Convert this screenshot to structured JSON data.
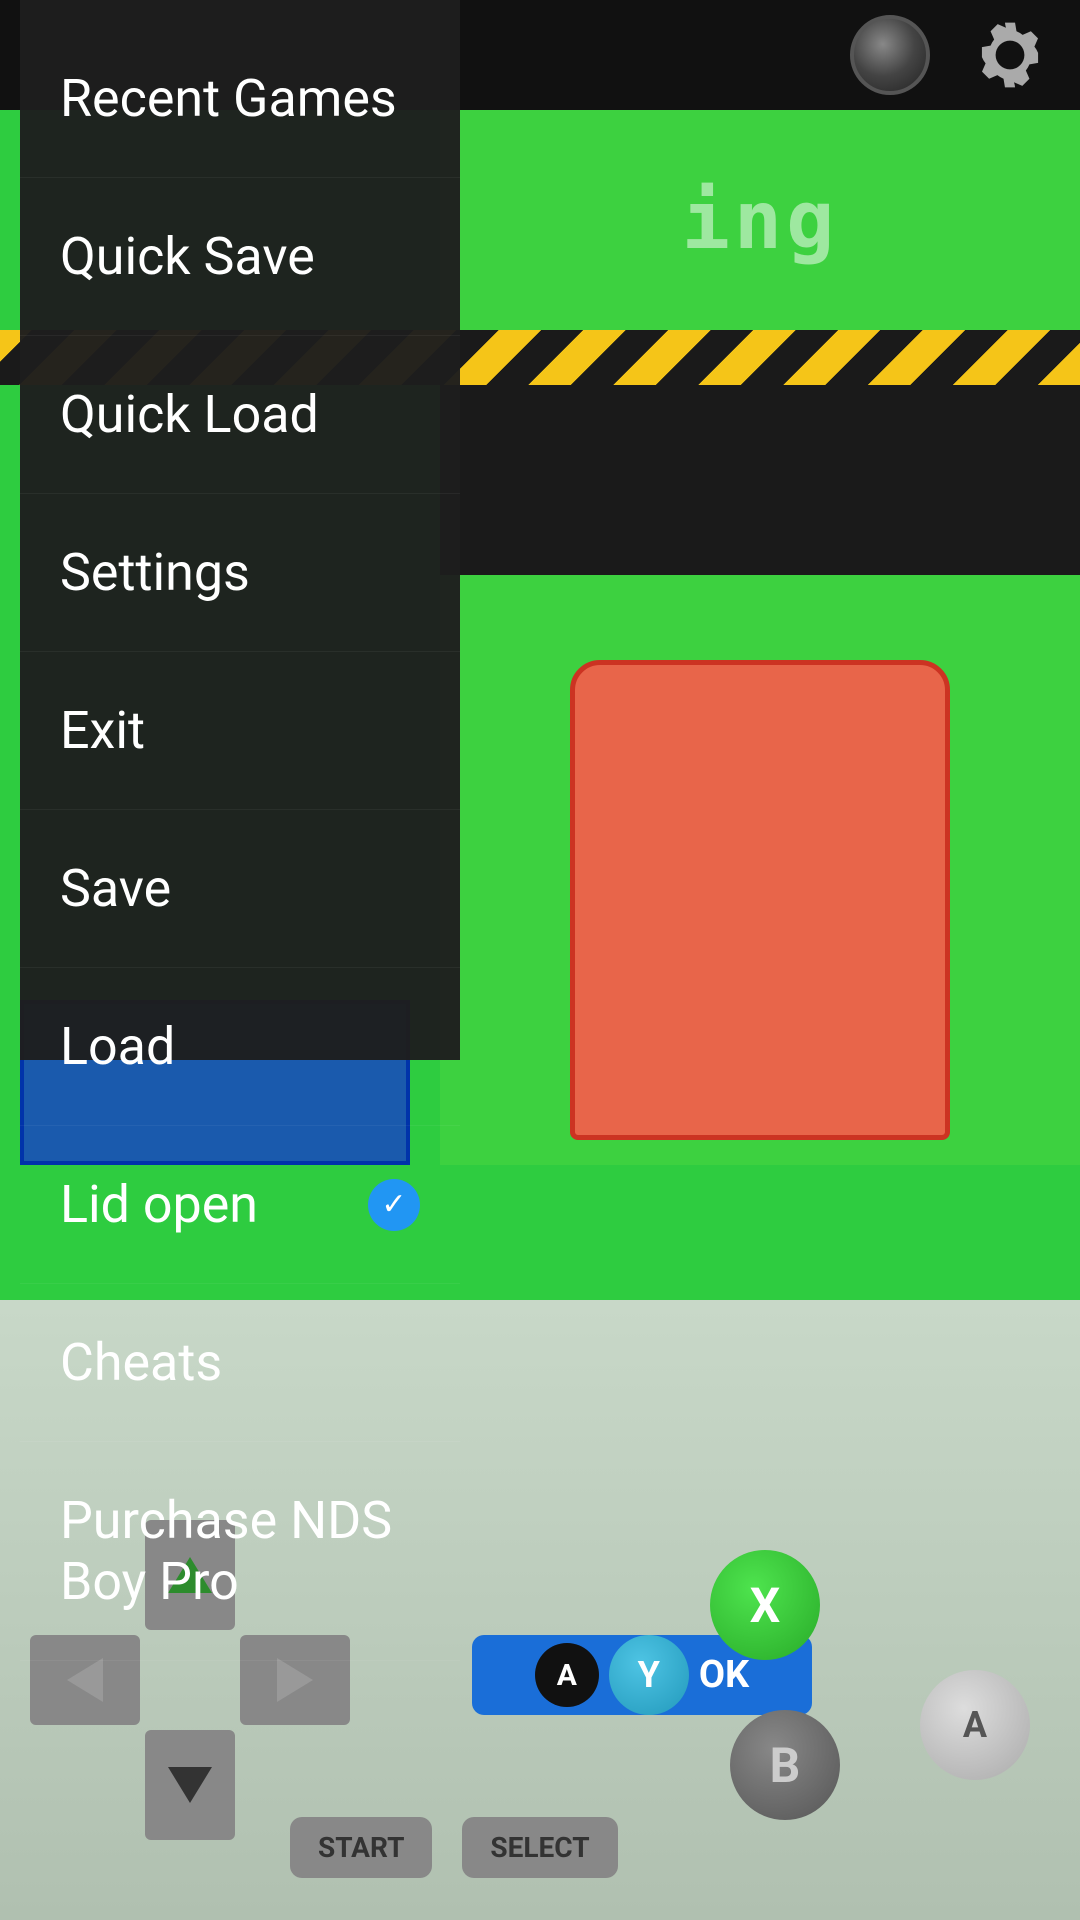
{
  "topbar": {
    "joystick_label": "joystick",
    "gear_label": "settings"
  },
  "game": {
    "text": "ing",
    "hazard": true
  },
  "menu": {
    "items": [
      {
        "id": "recent-games",
        "label": "Recent Games",
        "checked": false
      },
      {
        "id": "quick-save",
        "label": "Quick Save",
        "checked": false
      },
      {
        "id": "quick-load",
        "label": "Quick Load",
        "checked": false
      },
      {
        "id": "settings",
        "label": "Settings",
        "checked": false
      },
      {
        "id": "exit",
        "label": "Exit",
        "checked": false
      },
      {
        "id": "save",
        "label": "Save",
        "checked": false
      },
      {
        "id": "load",
        "label": "Load",
        "checked": false
      },
      {
        "id": "lid-open",
        "label": "Lid open",
        "checked": true
      },
      {
        "id": "cheats",
        "label": "Cheats",
        "checked": false
      },
      {
        "id": "purchase-nds",
        "label": "Purchase NDS Boy  Pro",
        "checked": false
      }
    ]
  },
  "controller": {
    "start_label": "START",
    "select_label": "SELECT",
    "btn_a": "A",
    "btn_b": "B",
    "btn_x": "X",
    "btn_y": "Y",
    "ok_label": "OK"
  }
}
